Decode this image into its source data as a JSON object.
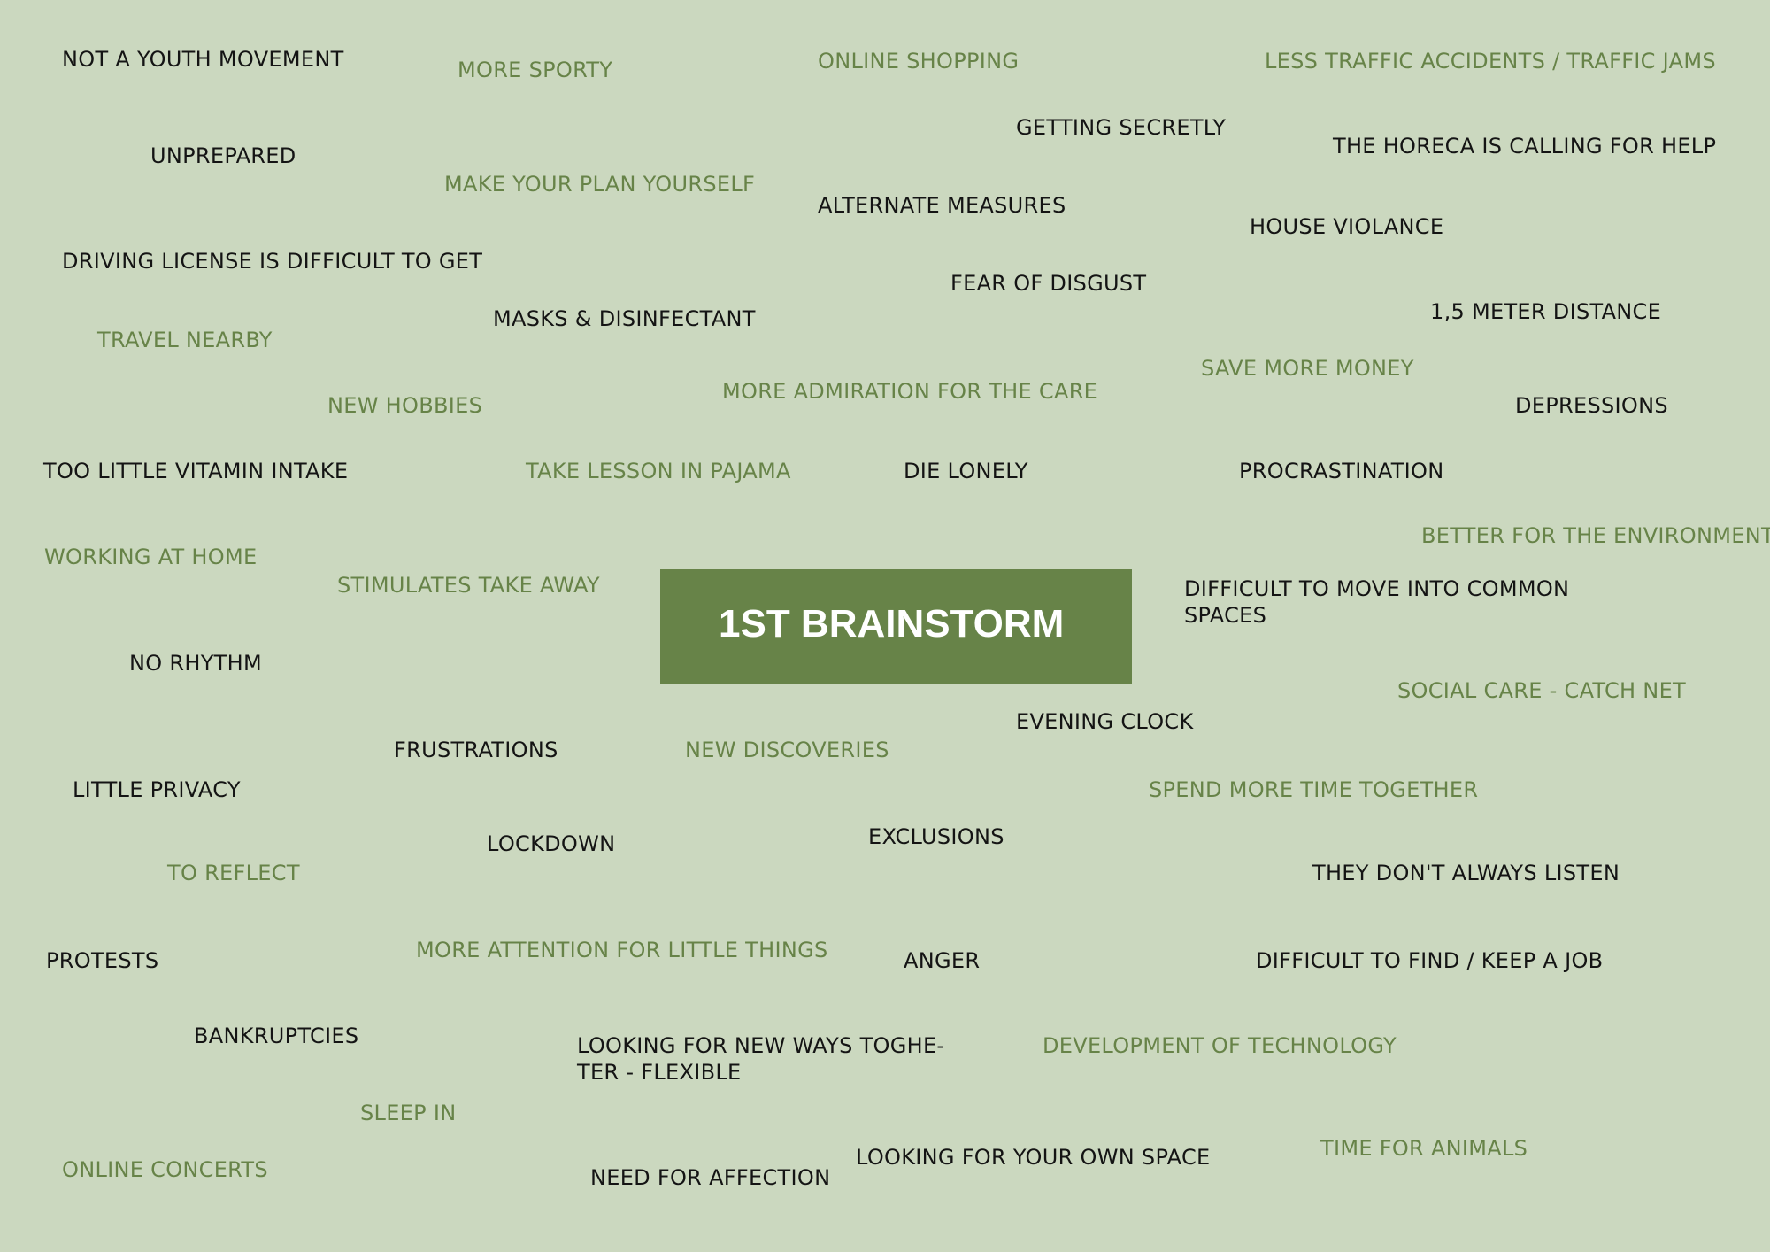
{
  "colors": {
    "background": "#cbd8bf",
    "accent_green": "#678348",
    "dark_text": "#141414",
    "title_text": "#ffffff"
  },
  "center": {
    "title": "1ST BRAINSTORM"
  },
  "items": [
    {
      "text": "NOT A YOUTH MOVEMENT",
      "tone": "dark"
    },
    {
      "text": "MORE SPORTY",
      "tone": "green"
    },
    {
      "text": "ONLINE SHOPPING",
      "tone": "green"
    },
    {
      "text": "LESS TRAFFIC ACCIDENTS / TRAFFIC JAMS",
      "tone": "green"
    },
    {
      "text": "GETTING SECRETLY",
      "tone": "dark"
    },
    {
      "text": "UNPREPARED",
      "tone": "dark"
    },
    {
      "text": "THE HORECA IS CALLING FOR HELP",
      "tone": "dark"
    },
    {
      "text": "MAKE YOUR PLAN YOURSELF",
      "tone": "green"
    },
    {
      "text": "ALTERNATE MEASURES",
      "tone": "dark"
    },
    {
      "text": "HOUSE VIOLANCE",
      "tone": "dark"
    },
    {
      "text": "DRIVING LICENSE IS DIFFICULT TO GET",
      "tone": "dark"
    },
    {
      "text": "FEAR OF DISGUST",
      "tone": "dark"
    },
    {
      "text": "1,5 METER DISTANCE",
      "tone": "dark"
    },
    {
      "text": "MASKS & DISINFECTANT",
      "tone": "dark"
    },
    {
      "text": "TRAVEL NEARBY",
      "tone": "green"
    },
    {
      "text": "SAVE MORE MONEY",
      "tone": "green"
    },
    {
      "text": "MORE ADMIRATION FOR THE CARE",
      "tone": "green"
    },
    {
      "text": "NEW HOBBIES",
      "tone": "green"
    },
    {
      "text": "DEPRESSIONS",
      "tone": "dark"
    },
    {
      "text": "TOO LITTLE VITAMIN INTAKE",
      "tone": "dark"
    },
    {
      "text": "TAKE LESSON IN PAJAMA",
      "tone": "green"
    },
    {
      "text": "DIE LONELY",
      "tone": "dark"
    },
    {
      "text": "PROCRASTINATION",
      "tone": "dark"
    },
    {
      "text": "BETTER FOR THE ENVIRONMENT",
      "tone": "green"
    },
    {
      "text": "WORKING AT HOME",
      "tone": "green"
    },
    {
      "text": "STIMULATES TAKE AWAY",
      "tone": "green"
    },
    {
      "text": "DIFFICULT TO MOVE INTO COMMON",
      "tone": "dark"
    },
    {
      "text": "SPACES",
      "tone": "dark"
    },
    {
      "text": "NO RHYTHM",
      "tone": "dark"
    },
    {
      "text": "SOCIAL CARE - CATCH NET",
      "tone": "green"
    },
    {
      "text": "EVENING CLOCK",
      "tone": "dark"
    },
    {
      "text": "FRUSTRATIONS",
      "tone": "dark"
    },
    {
      "text": "NEW DISCOVERIES",
      "tone": "green"
    },
    {
      "text": "LITTLE PRIVACY",
      "tone": "dark"
    },
    {
      "text": "SPEND MORE TIME TOGETHER",
      "tone": "green"
    },
    {
      "text": "LOCKDOWN",
      "tone": "dark"
    },
    {
      "text": "EXCLUSIONS",
      "tone": "dark"
    },
    {
      "text": "TO REFLECT",
      "tone": "green"
    },
    {
      "text": "THEY DON'T ALWAYS LISTEN",
      "tone": "dark"
    },
    {
      "text": "PROTESTS",
      "tone": "dark"
    },
    {
      "text": "MORE ATTENTION FOR LITTLE THINGS",
      "tone": "green"
    },
    {
      "text": "ANGER",
      "tone": "dark"
    },
    {
      "text": "DIFFICULT TO FIND / KEEP A JOB",
      "tone": "dark"
    },
    {
      "text": "BANKRUPTCIES",
      "tone": "dark"
    },
    {
      "text": "LOOKING FOR NEW WAYS TOGHE-",
      "tone": "dark"
    },
    {
      "text": "TER - FLEXIBLE",
      "tone": "dark"
    },
    {
      "text": "DEVELOPMENT OF TECHNOLOGY",
      "tone": "green"
    },
    {
      "text": "SLEEP IN",
      "tone": "green"
    },
    {
      "text": "ONLINE CONCERTS",
      "tone": "green"
    },
    {
      "text": "NEED FOR AFFECTION",
      "tone": "dark"
    },
    {
      "text": "LOOKING FOR YOUR OWN SPACE",
      "tone": "dark"
    },
    {
      "text": "TIME FOR ANIMALS",
      "tone": "green"
    }
  ]
}
